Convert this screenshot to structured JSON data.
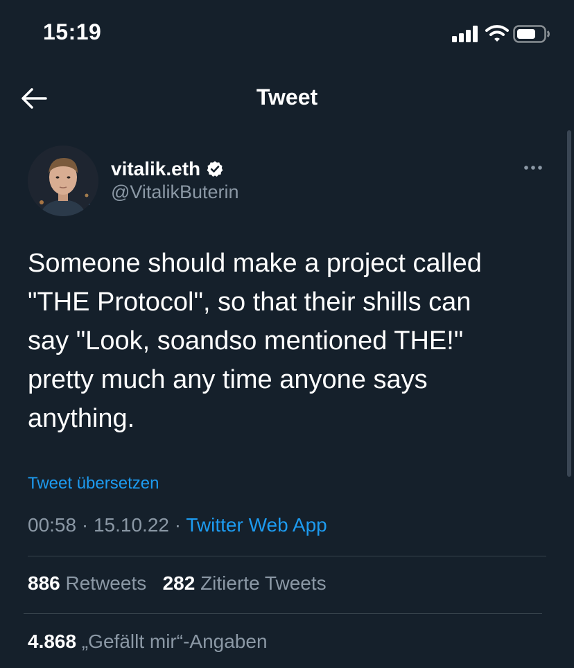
{
  "status_bar": {
    "time": "15:19",
    "icons": [
      "signal-icon",
      "wifi-icon",
      "battery-icon"
    ]
  },
  "nav": {
    "back_icon": "arrow-left-icon",
    "title": "Tweet"
  },
  "tweet": {
    "author": {
      "display_name": "vitalik.eth",
      "handle": "@VitalikButerin",
      "verified": true
    },
    "text": "Someone should make a project called\n\"THE Protocol\", so that their shills can\nsay \"Look, soandso mentioned THE!\"\npretty much any time anyone says\nanything.",
    "translate_label": "Tweet übersetzen",
    "time": "00:58",
    "separator": "·",
    "date": "15.10.22",
    "source": "Twitter Web App",
    "stats": {
      "retweets_count": "886",
      "retweets_label": "Retweets",
      "quotes_count": "282",
      "quotes_label": "Zitierte Tweets",
      "likes_count": "4.868",
      "likes_label": "„Gefällt mir“-Angaben"
    }
  },
  "colors": {
    "background": "#15202b",
    "text_primary": "#ffffff",
    "text_secondary": "#8b98a5",
    "accent": "#1d9bf0",
    "divider": "#38444d"
  }
}
